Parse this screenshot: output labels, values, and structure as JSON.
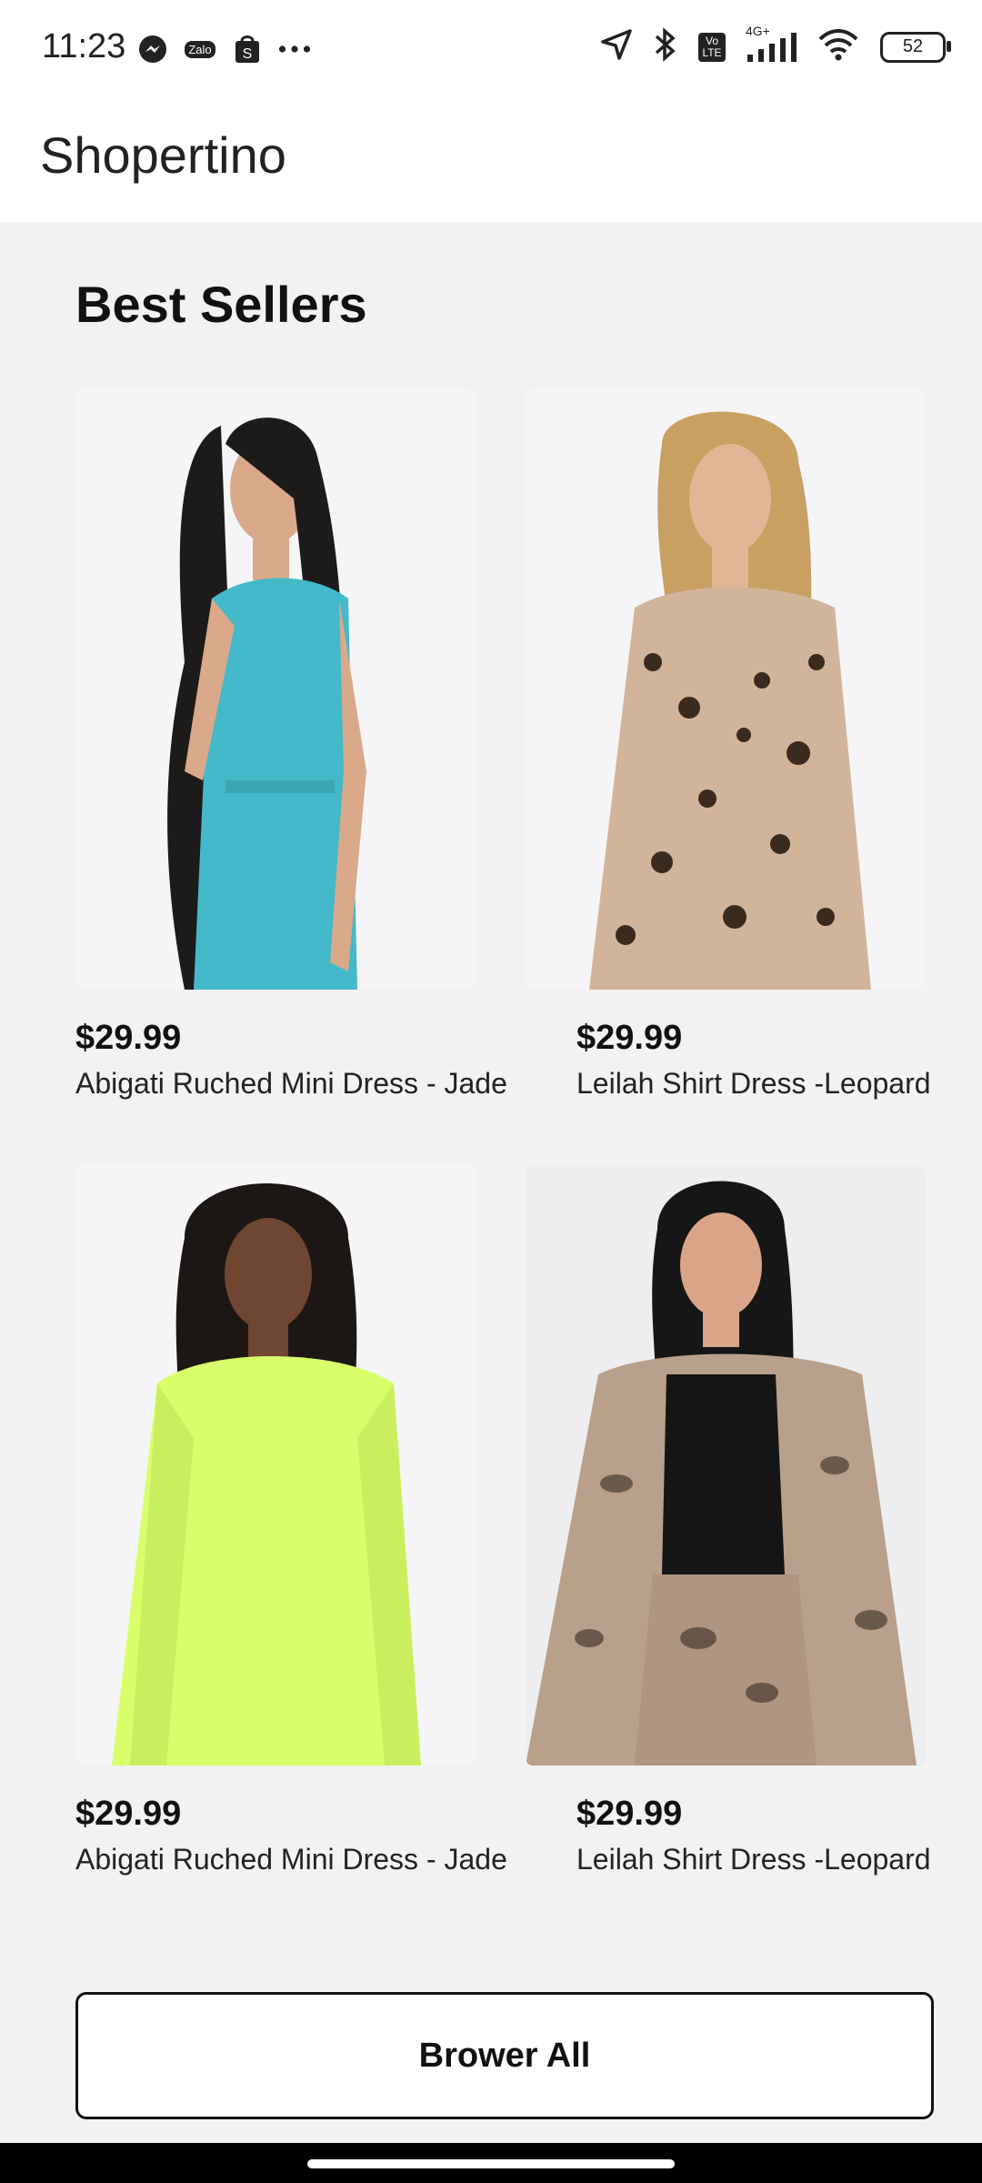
{
  "status_bar": {
    "time": "11:23",
    "left_icons": [
      "messenger-icon",
      "zalo-icon",
      "shop-icon",
      "more-dots-icon"
    ],
    "zalo_label": "Zalo",
    "right_icons": [
      "location-arrow-icon",
      "bluetooth-icon",
      "volte-icon",
      "signal-icon",
      "wifi-icon"
    ],
    "network_label": "4G+",
    "volte_label": "Vo LTE",
    "battery": "52"
  },
  "app": {
    "title": "Shopertino"
  },
  "section": {
    "title": "Best Sellers"
  },
  "products": [
    {
      "price": "$29.99",
      "name": "Abigati Ruched Mini Dress - Jade",
      "image_color": "#43b9c9",
      "image": "turquoise-wrap-dress-model-photo"
    },
    {
      "price": "$29.99",
      "name": "Leilah Shirt Dress -Leopard",
      "image_color": "#c9a78a",
      "image": "leopard-shirt-dress-model-photo"
    },
    {
      "price": "$29.99",
      "name": "Abigati Ruched Mini Dress - Jade",
      "image_color": "#d8ff6a",
      "image": "neon-sweater-dress-model-photo"
    },
    {
      "price": "$29.99",
      "name": "Leilah Shirt Dress -Leopard",
      "image_color": "#b59a84",
      "image": "snakeskin-set-model-photo"
    }
  ],
  "browse_button": {
    "label": "Brower All"
  },
  "colors": {
    "background": "#f2f2f3",
    "header": "#ffffff",
    "text": "#111111",
    "button_border": "#111111"
  }
}
